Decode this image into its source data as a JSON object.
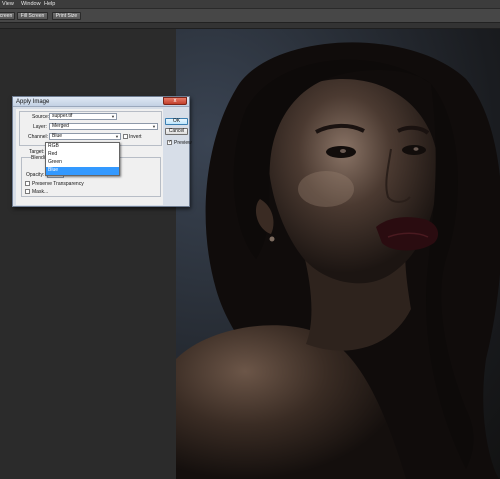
{
  "menubar": {
    "items": [
      "View",
      "Window",
      "Help"
    ]
  },
  "options_bar": {
    "buttons": [
      "creen",
      "Fill Screen",
      "Print Size"
    ]
  },
  "dialog": {
    "title": "Apply Image",
    "close": "x",
    "source": {
      "label": "Source:",
      "value": "supper.tif"
    },
    "layer": {
      "label": "Layer:",
      "value": "Merged"
    },
    "channel": {
      "label": "Channel:",
      "value": "Blue",
      "invert_label": "Invert",
      "invert_checked": false
    },
    "target_label": "Target:",
    "blending_label": "Blendi",
    "opacity": {
      "label": "Opacity:",
      "value": "100",
      "unit": "%"
    },
    "preserve_transparency_label": "Preserve Transparency",
    "mask_label": "Mask...",
    "ok_label": "OK",
    "cancel_label": "Cancel",
    "preview_label": "Preview",
    "preview_checked": true,
    "channel_options": [
      "RGB",
      "Red",
      "Green",
      "Blue"
    ],
    "channel_selected": "Blue"
  }
}
